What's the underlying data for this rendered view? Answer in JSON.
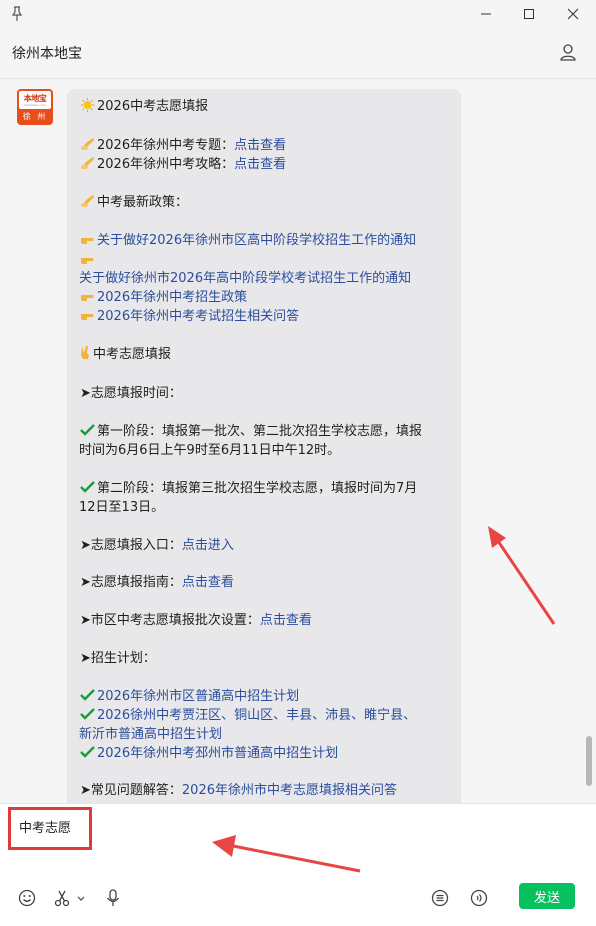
{
  "header": {
    "title": "徐州本地宝"
  },
  "avatar": {
    "brand": "本地宝",
    "site": "bendibao.com",
    "city": "徐 州"
  },
  "message": {
    "l1": "2026中考志愿填报",
    "l2": "2026年徐州中考专题：",
    "l2_link": "点击查看",
    "l3": "2026年徐州中考攻略：",
    "l3_link": "点击查看",
    "l4": "中考最新政策：",
    "l5": "关于做好2026年徐州市区高中阶段学校招生工作的通知",
    "l6": "关于做好徐州市2026年高中阶段学校考试招生工作的通知",
    "l7": "2026年徐州中考招生政策",
    "l8": "2026年徐州中考考试招生相关问答",
    "l9": "中考志愿填报",
    "l10": "➤志愿填报时间：",
    "l11": "第一阶段：填报第一批次、第二批次招生学校志愿，填报",
    "l12": "时间为6月6日上午9时至6月11日中午12时。",
    "l13": "第二阶段：填报第三批次招生学校志愿，填报时间为7月",
    "l14": "12日至13日。",
    "l15": "➤志愿填报入口：",
    "l15_link": "点击进入",
    "l16": "➤志愿填报指南：",
    "l16_link": "点击查看",
    "l17": "➤市区中考志愿填报批次设置：",
    "l17_link": "点击查看",
    "l18": "➤招生计划：",
    "l19": "2026年徐州市区普通高中招生计划",
    "l20": "2026徐州中考贾汪区、铜山区、丰县、沛县、睢宁县、",
    "l21": "新沂市普通高中招生计划",
    "l22": "2026年徐州中考邳州市普通高中招生计划",
    "l23": "➤常见问题解答：",
    "l23_link": "2026年徐州市中考志愿填报相关问答"
  },
  "input": {
    "value": "中考志愿"
  },
  "send_label": "发送",
  "icons": {
    "pin": "pin-icon",
    "minimize": "minimize-icon",
    "maximize": "maximize-icon",
    "close": "close-icon",
    "user": "user-icon",
    "emoji": "emoji-icon",
    "scissors": "scissors-icon",
    "mic": "mic-icon",
    "list": "list-icon",
    "voice": "voice-icon"
  },
  "colors": {
    "accent": "#07c160",
    "link": "#2b4d9b",
    "highlight": "#e03a3a",
    "bubble": "#e8e8eb"
  }
}
